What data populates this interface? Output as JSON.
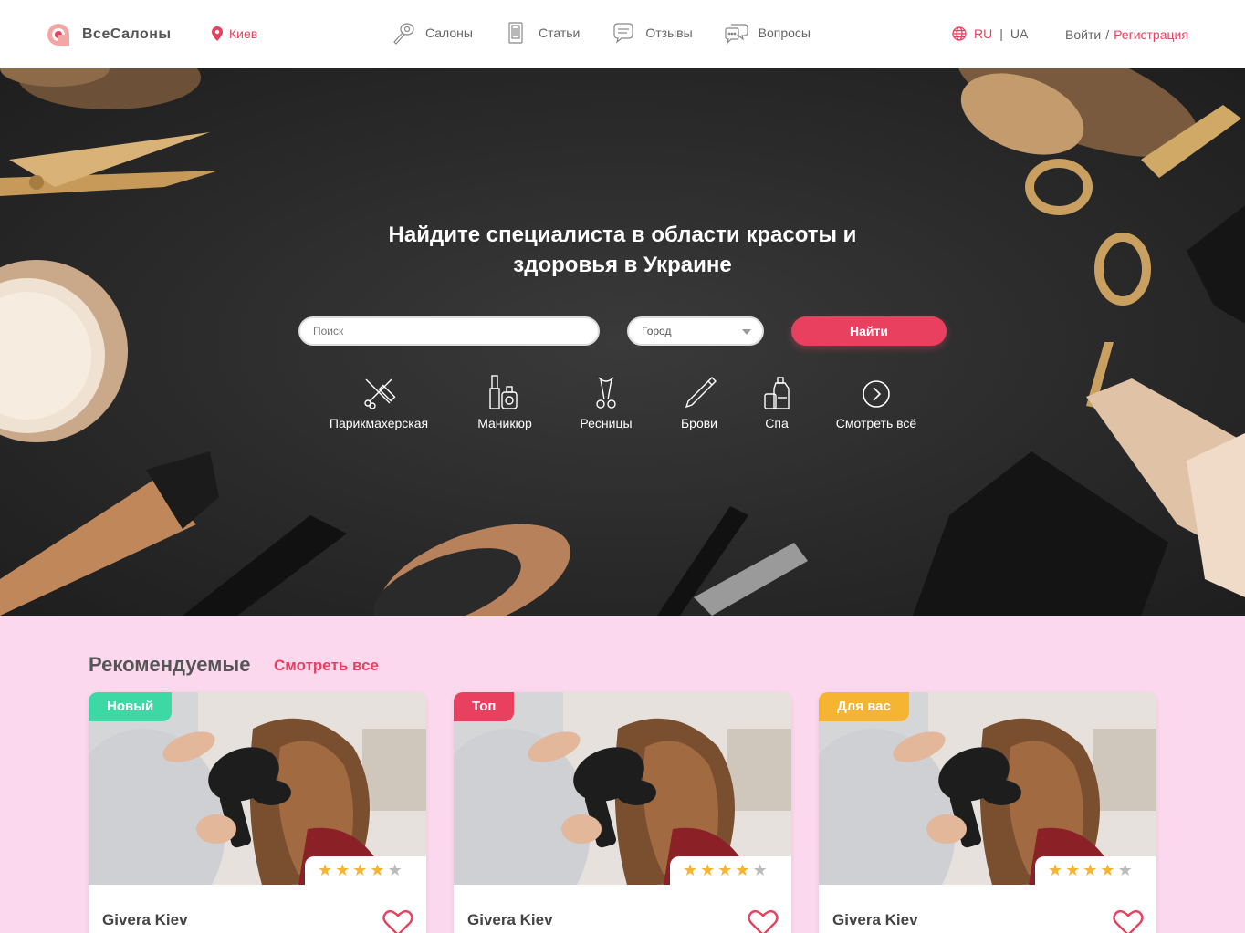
{
  "header": {
    "logo_text": "ВсеСалоны",
    "city": "Киев",
    "nav": [
      {
        "label": "Салоны",
        "icon": "dryer-icon"
      },
      {
        "label": "Статьи",
        "icon": "article-icon"
      },
      {
        "label": "Отзывы",
        "icon": "reviews-icon"
      },
      {
        "label": "Вопросы",
        "icon": "questions-icon"
      }
    ],
    "lang_ru": "RU",
    "lang_sep": "|",
    "lang_ua": "UA",
    "login": "Войти",
    "auth_sep": "/",
    "register": "Регистрация"
  },
  "hero": {
    "title_line1": "Найдите специалиста в области красоты и",
    "title_line2": "здоровья в Украине",
    "search_placeholder": "Поиск",
    "city_placeholder": "Город",
    "find_button": "Найти",
    "categories": [
      {
        "label": "Парикмахерская",
        "icon": "scissors-comb-icon"
      },
      {
        "label": "Маникюр",
        "icon": "nail-polish-icon"
      },
      {
        "label": "Ресницы",
        "icon": "eyelash-curler-icon"
      },
      {
        "label": "Брови",
        "icon": "brow-pencil-icon"
      },
      {
        "label": "Спа",
        "icon": "spa-bottle-icon"
      },
      {
        "label": "Смотреть всё",
        "icon": "arrow-circle-icon"
      }
    ]
  },
  "recommended": {
    "title": "Рекомендуемые",
    "see_all": "Смотреть все",
    "cards": [
      {
        "badge": "Новый",
        "badge_color": "#3dd9a4",
        "name": "Givera Kiev",
        "rating": 4,
        "rating_max": 5
      },
      {
        "badge": "Топ",
        "badge_color": "#e8405e",
        "name": "Givera Kiev",
        "rating": 4,
        "rating_max": 5
      },
      {
        "badge": "Для вас",
        "badge_color": "#f5b431",
        "name": "Givera Kiev",
        "rating": 4,
        "rating_max": 5
      }
    ]
  },
  "colors": {
    "accent": "#e8405e",
    "section_bg": "#fbd8ee"
  }
}
